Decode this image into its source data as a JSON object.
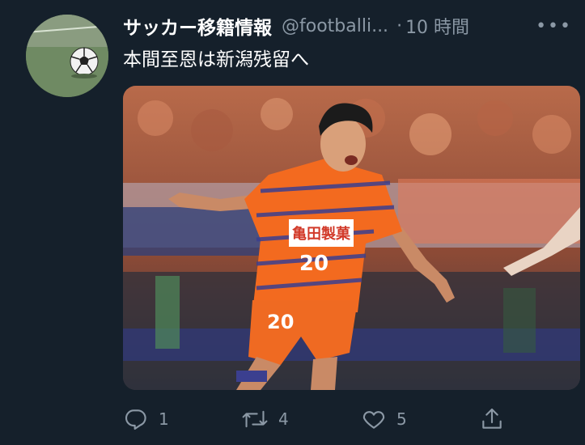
{
  "tweet": {
    "author_name": "サッカー移籍情報",
    "author_handle": "@footballi...",
    "separator": "·",
    "timestamp": "10 時間",
    "more_label": "•••",
    "text": "本間至恩は新潟残留へ"
  },
  "media": {
    "jersey_number": "20",
    "sponsor_text": "亀田製菓",
    "team_colors": {
      "primary": "#f36a1f",
      "stripe": "#3b3f8f"
    }
  },
  "actions": {
    "reply_count": "1",
    "retweet_count": "4",
    "like_count": "5"
  },
  "icons": {
    "reply": "reply-icon",
    "retweet": "retweet-icon",
    "like": "heart-icon",
    "share": "share-icon",
    "more": "more-icon"
  },
  "colors": {
    "background": "#15202b",
    "text_primary": "#ffffff",
    "text_secondary": "#8b98a5"
  }
}
